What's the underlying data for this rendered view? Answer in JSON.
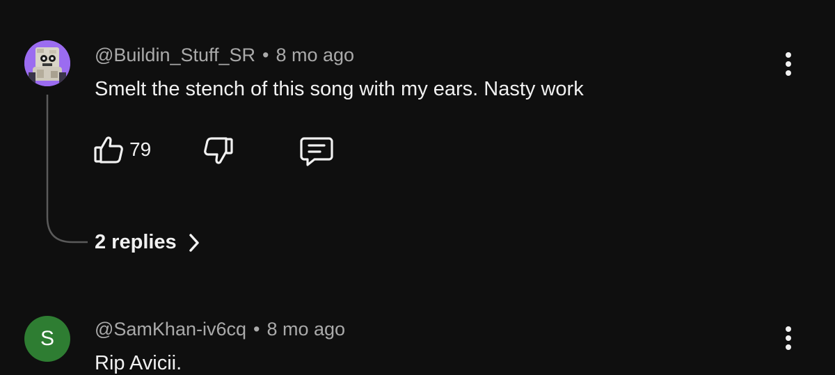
{
  "comments": [
    {
      "author": "@Buildin_Stuff_SR",
      "time": "8 mo ago",
      "text": "Smelt the stench of this song with my ears. Nasty work",
      "likes": "79",
      "replies_label": "2 replies",
      "avatar_bg": "#9b6cf0"
    },
    {
      "author": "@SamKhan-iv6cq",
      "time": "8 mo ago",
      "text": "Rip Avicii.",
      "avatar_letter": "S",
      "avatar_bg": "#2e7d32"
    }
  ],
  "meta_separator": "•",
  "icons": {
    "like": "thumbs-up-icon",
    "dislike": "thumbs-down-icon",
    "reply": "comment-icon",
    "more": "more-vert-icon",
    "expand": "chevron-right-icon"
  },
  "colors": {
    "background": "#0f0f0f",
    "primary_text": "#f1f1f1",
    "secondary_text": "#aaaaaa",
    "thread_line": "#5a5a5a"
  }
}
